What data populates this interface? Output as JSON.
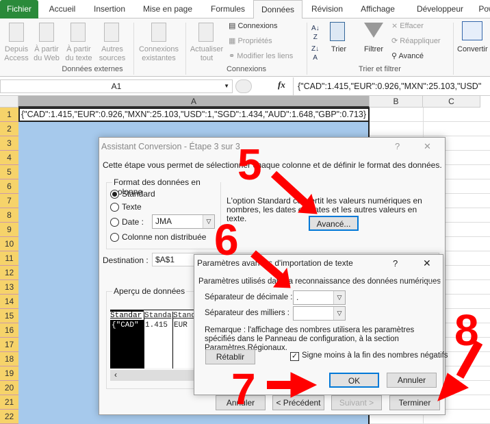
{
  "tabs": [
    "Fichier",
    "Accueil",
    "Insertion",
    "Mise en page",
    "Formules",
    "Données",
    "Révision",
    "Affichage",
    "Développeur",
    "Pow"
  ],
  "ribbon": {
    "ext": [
      "Depuis Access",
      "À partir du Web",
      "À partir du texte",
      "Autres sources",
      "Connexions existantes"
    ],
    "ext_group": "Données externes",
    "refresh": "Actualiser tout",
    "conn_items": [
      "Connexions",
      "Propriétés",
      "Modifier les liens"
    ],
    "conn_group": "Connexions",
    "sort_label": "Trier",
    "filter_label": "Filtrer",
    "filter_items": [
      "Effacer",
      "Réappliquer",
      "Avancé"
    ],
    "sort_group": "Trier et filtrer",
    "convert": "Convertir"
  },
  "formula_bar": {
    "name_box": "A1",
    "fx": "fx",
    "value": "{\"CAD\":1.415,\"EUR\":0.926,\"MXN\":25.103,\"USD\""
  },
  "grid": {
    "columns": [
      "A",
      "B",
      "C"
    ],
    "rows": [
      "1",
      "2",
      "3",
      "4",
      "5",
      "6",
      "7",
      "8",
      "9",
      "10",
      "11",
      "12",
      "13",
      "14",
      "15",
      "16",
      "17",
      "18",
      "19",
      "20",
      "21",
      "22"
    ],
    "a1": "{\"CAD\":1.415,\"EUR\":0.926,\"MXN\":25.103,\"USD\":1,\"SGD\":1.434,\"AUD\":1.648,\"GBP\":0.713}"
  },
  "wizard": {
    "title": "Assistant Conversion - Étape 3 sur 3",
    "help": "?",
    "close": "✕",
    "intro": "Cette étape vous permet de sélectionner chaque colonne et de définir le format des données.",
    "format_legend": "Format des données en colonne",
    "options": [
      "Standard",
      "Texte",
      "Date :",
      "Colonne non distribuée"
    ],
    "date_value": "JMA",
    "note": "L'option Standard convertit les valeurs numériques en nombres, les dates en dates et les autres valeurs en texte.",
    "advanced": "Avancé...",
    "dest_label": "Destination :",
    "dest_value": "$A$1",
    "preview_legend": "Aperçu de données",
    "preview_headers": [
      "Standar",
      "Standa",
      "Stand"
    ],
    "preview_row": [
      "{\"CAD\"",
      "1.415",
      "EUR"
    ],
    "buttons": [
      "Annuler",
      "< Précédent",
      "Suivant >",
      "Terminer"
    ]
  },
  "advanced_dialog": {
    "title": "Paramètres avancés d'importation de texte",
    "help": "?",
    "close": "✕",
    "section": "Paramètres utilisés dans la reconnaissance des données numériques",
    "decimal_label": "Séparateur de décimale :",
    "decimal_value": ".",
    "thousands_label": "Séparateur des milliers :",
    "thousands_value": "",
    "remark": "Remarque : l'affichage des nombres utilisera les paramètres spécifiés dans le Panneau de configuration, à la section Paramètres Régionaux.",
    "reset": "Rétablir",
    "checkbox_label": "Signe moins à la fin des nombres négatifs",
    "checkbox_checked": true,
    "ok": "OK",
    "cancel": "Annuler"
  },
  "annotations": [
    "5",
    "6",
    "7",
    "8"
  ],
  "colors": {
    "annotation": "#ff0000",
    "selection": "#a6c9ec",
    "file_tab": "#2a8a3a",
    "default_btn": "#0078d7"
  }
}
